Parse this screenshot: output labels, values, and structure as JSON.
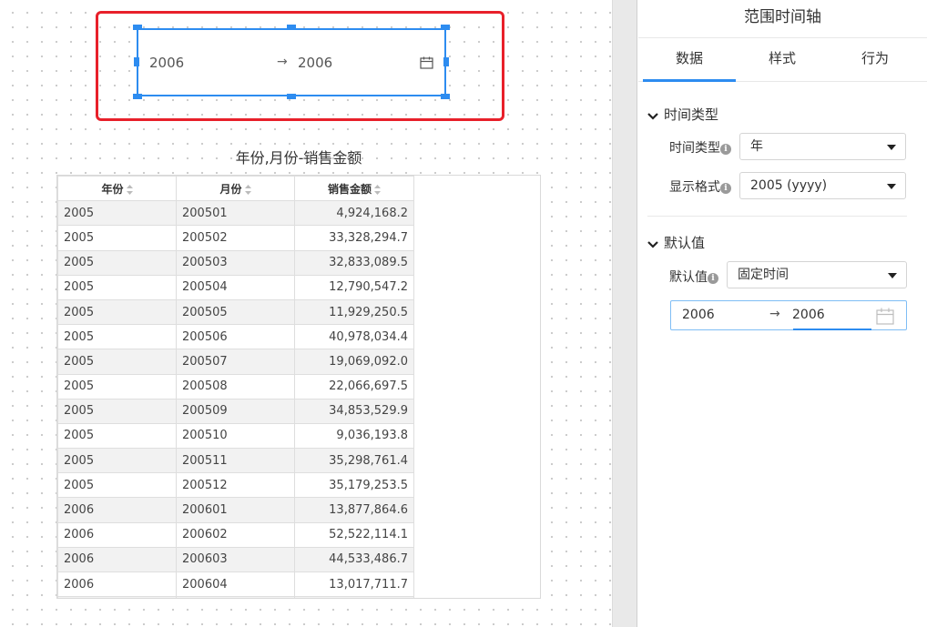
{
  "canvas": {
    "timeline_widget": {
      "start_value": "2006",
      "separator": "→",
      "end_value": "2006",
      "calendar_icon": "calendar-icon"
    },
    "table": {
      "title": "年份,月份-销售金额",
      "columns": [
        "年份",
        "月份",
        "销售金额"
      ],
      "rows": [
        [
          "2005",
          "200501",
          "4,924,168.2"
        ],
        [
          "2005",
          "200502",
          "33,328,294.7"
        ],
        [
          "2005",
          "200503",
          "32,833,089.5"
        ],
        [
          "2005",
          "200504",
          "12,790,547.2"
        ],
        [
          "2005",
          "200505",
          "11,929,250.5"
        ],
        [
          "2005",
          "200506",
          "40,978,034.4"
        ],
        [
          "2005",
          "200507",
          "19,069,092.0"
        ],
        [
          "2005",
          "200508",
          "22,066,697.5"
        ],
        [
          "2005",
          "200509",
          "34,853,529.9"
        ],
        [
          "2005",
          "200510",
          "9,036,193.8"
        ],
        [
          "2005",
          "200511",
          "35,298,761.4"
        ],
        [
          "2005",
          "200512",
          "35,179,253.5"
        ],
        [
          "2006",
          "200601",
          "13,877,864.6"
        ],
        [
          "2006",
          "200602",
          "52,522,114.1"
        ],
        [
          "2006",
          "200603",
          "44,533,486.7"
        ],
        [
          "2006",
          "200604",
          "13,017,711.7"
        ],
        [
          "",
          "",
          ""
        ]
      ]
    }
  },
  "panel": {
    "title": "范围时间轴",
    "tabs": [
      {
        "label": "数据",
        "active": true
      },
      {
        "label": "样式",
        "active": false
      },
      {
        "label": "行为",
        "active": false
      }
    ],
    "time_type_section": {
      "heading": "时间类型",
      "time_type_label": "时间类型",
      "time_type_value": "年",
      "display_format_label": "显示格式",
      "display_format_value": "2005 (yyyy)"
    },
    "default_section": {
      "heading": "默认值",
      "default_label": "默认值",
      "default_value": "固定时间",
      "range_start": "2006",
      "range_separator": "→",
      "range_end": "2006"
    }
  },
  "colors": {
    "accent": "#2d8cf0",
    "highlight": "#e8202a",
    "stripe": "#f2f2f2"
  }
}
